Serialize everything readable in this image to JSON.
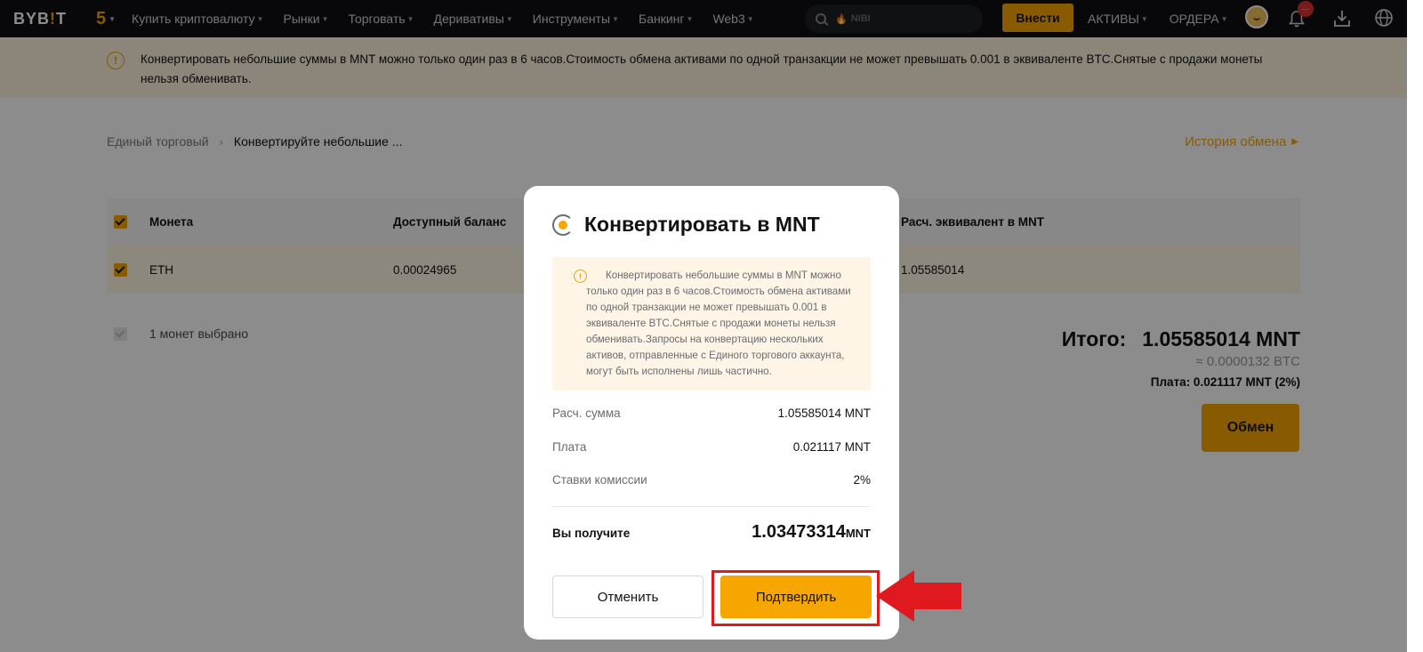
{
  "nav": {
    "logo_main": "BYB",
    "logo_accent": "!",
    "logo_tail": "T",
    "anniversary": "5",
    "menu": [
      "Купить криптовалюту",
      "Рынки",
      "Торговать",
      "Деривативы",
      "Инструменты",
      "Банкинг",
      "Web3"
    ],
    "search_placeholder": "NIBI",
    "deposit_label": "Внести",
    "assets_label": "АКТИВЫ",
    "orders_label": "ОРДЕРА",
    "notification_badge": "···"
  },
  "banner": {
    "text": "Конвертировать небольшие суммы в MNT можно только один раз в 6 часов.Стоимость обмена активами по одной транзакции не может превышать 0.001 в эквиваленте BTC.Снятые с продажи монеты нельзя обменивать."
  },
  "breadcrumb": {
    "parent": "Единый торговый",
    "current": "Конвертируйте небольшие ..."
  },
  "history_link": "История обмена",
  "table": {
    "headers": {
      "coin": "Монета",
      "balance": "Доступный баланс",
      "mnt_equiv": "Расч. эквивалент в MNT"
    },
    "rows": [
      {
        "coin": "ETH",
        "balance": "0.00024965",
        "mnt_equiv": "1.05585014"
      }
    ]
  },
  "selected_count": "1 монет выбрано",
  "summary": {
    "total_label": "Итого:",
    "total_value": "1.05585014 MNT",
    "btc_equiv": "≈ 0.0000132 BTC",
    "fee_line": "Плата: 0.021117 MNT (2%)",
    "swap_label": "Обмен"
  },
  "modal": {
    "title": "Конвертировать в MNT",
    "notice": "Конвертировать небольшие суммы в MNT можно только один раз в 6 часов.Стоимость обмена активами по одной транзакции не может превышать 0.001 в эквиваленте BTC.Снятые с продажи монеты нельзя обменивать.Запросы на конвертацию нескольких активов, отправленные с Единого торгового аккаунта, могут быть исполнены лишь частично.",
    "details": [
      {
        "label": "Расч. сумма",
        "value": "1.05585014 MNT"
      },
      {
        "label": "Плата",
        "value": "0.021117 MNT"
      },
      {
        "label": "Ставки комиссии",
        "value": "2%"
      }
    ],
    "receive_label": "Вы получите",
    "receive_amount": "1.03473314",
    "receive_unit": "MNT",
    "cancel_label": "Отменить",
    "confirm_label": "Подтвердить"
  },
  "colors": {
    "accent": "#f7a600",
    "nav_bg": "#101014",
    "highlight": "#e0191f"
  }
}
